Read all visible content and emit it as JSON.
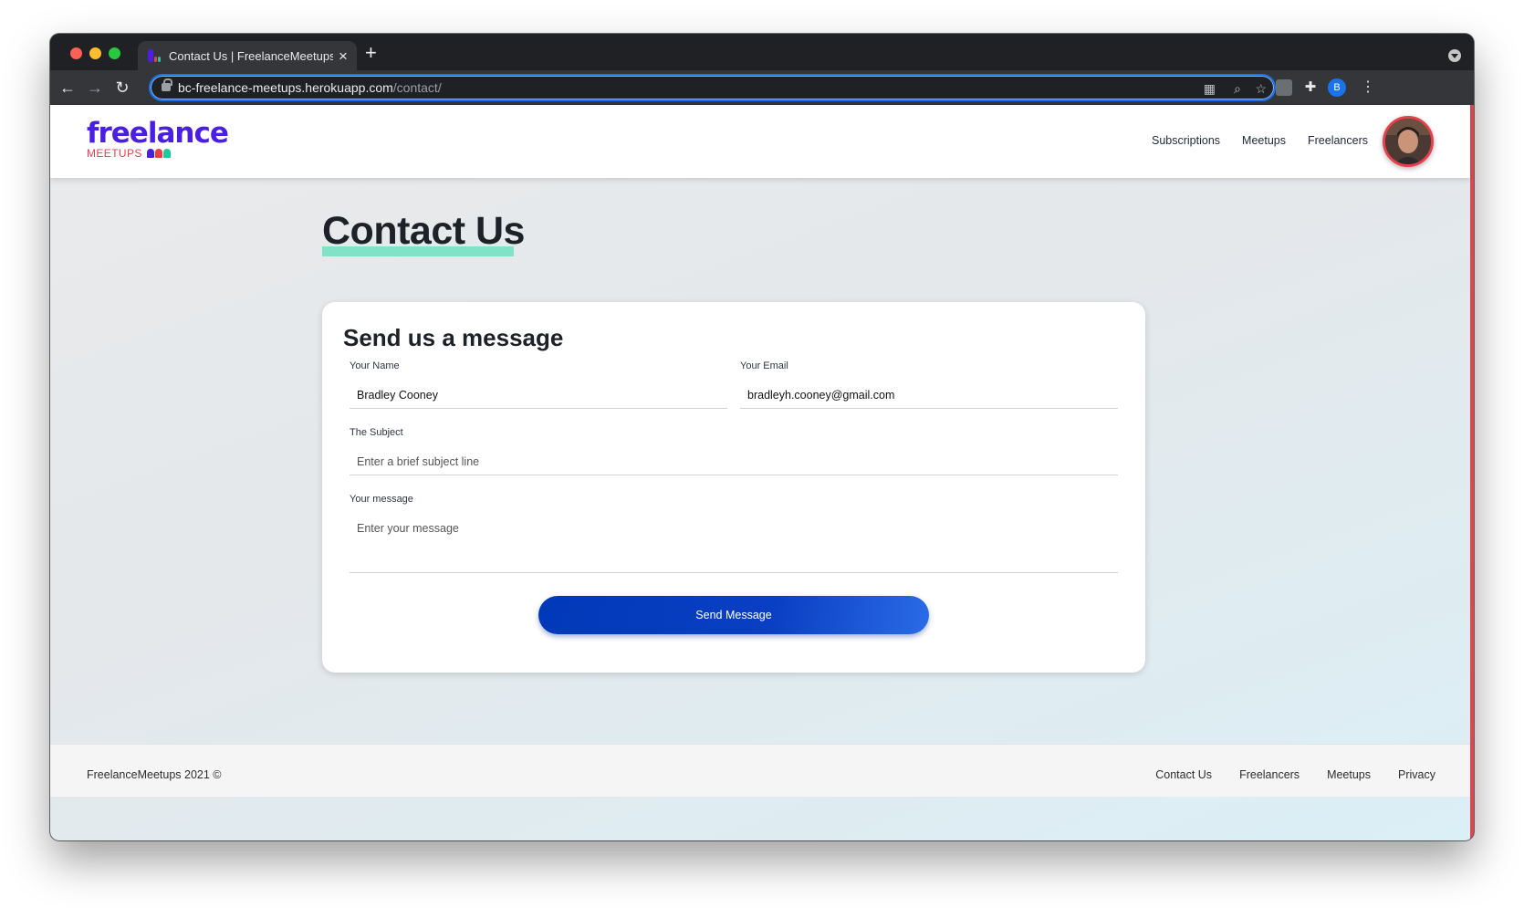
{
  "browser": {
    "tab_title": "Contact Us | FreelanceMeetups",
    "url_host": "bc-freelance-meetups.herokuapp.com",
    "url_path": "/contact/",
    "profile_initial": "B"
  },
  "header": {
    "logo_word": "freelance",
    "logo_sub": "MEETUPS",
    "nav": [
      "Subscriptions",
      "Meetups",
      "Freelancers"
    ]
  },
  "main": {
    "page_title": "Contact Us",
    "form": {
      "heading": "Send us a message",
      "name_label": "Your Name",
      "name_value": "Bradley Cooney",
      "email_label": "Your Email",
      "email_value": "bradleyh.cooney@gmail.com",
      "subject_label": "The Subject",
      "subject_placeholder": "Enter a brief subject line",
      "message_label": "Your message",
      "message_placeholder": "Enter your message",
      "submit_label": "Send Message"
    }
  },
  "footer": {
    "copyright": "FreelanceMeetups 2021 ©",
    "links": [
      "Contact Us",
      "Freelancers",
      "Meetups",
      "Privacy"
    ]
  },
  "colors": {
    "brand_purple": "#4a1fe0",
    "brand_red": "#e5404c",
    "accent_teal": "#6fe0c2",
    "button_blue": "#0039b8"
  }
}
